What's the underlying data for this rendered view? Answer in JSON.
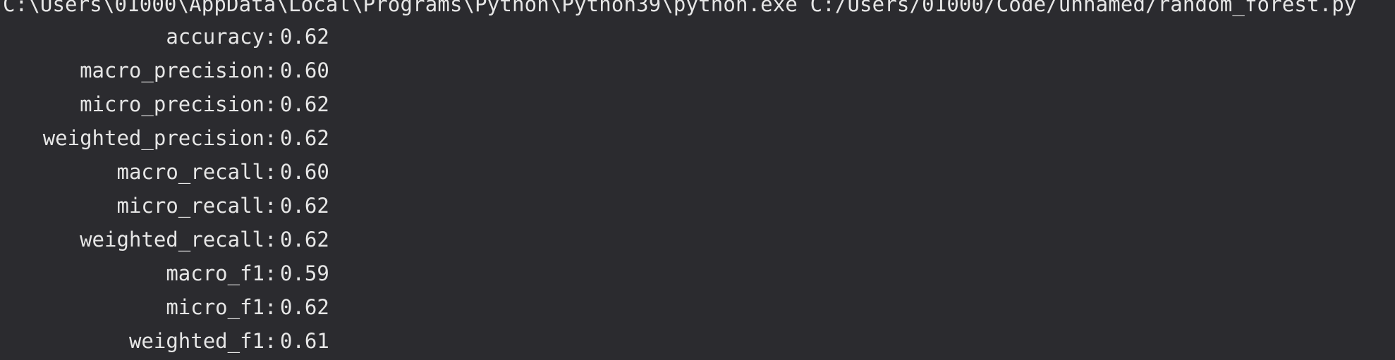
{
  "command_line": "C:\\Users\\01000\\AppData\\Local\\Programs\\Python\\Python39\\python.exe C:/Users/01000/Code/unnamed/random_forest.py",
  "metrics": [
    {
      "name": "accuracy",
      "value": "0.62"
    },
    {
      "name": "macro_precision",
      "value": "0.60"
    },
    {
      "name": "micro_precision",
      "value": "0.62"
    },
    {
      "name": "weighted_precision",
      "value": "0.62"
    },
    {
      "name": "macro_recall",
      "value": "0.60"
    },
    {
      "name": "micro_recall",
      "value": "0.62"
    },
    {
      "name": "weighted_recall",
      "value": "0.62"
    },
    {
      "name": "macro_f1",
      "value": "0.59"
    },
    {
      "name": "micro_f1",
      "value": "0.62"
    },
    {
      "name": "weighted_f1",
      "value": "0.61"
    }
  ],
  "colors": {
    "background": "#2b2b2f",
    "text": "#e6e6e6"
  }
}
